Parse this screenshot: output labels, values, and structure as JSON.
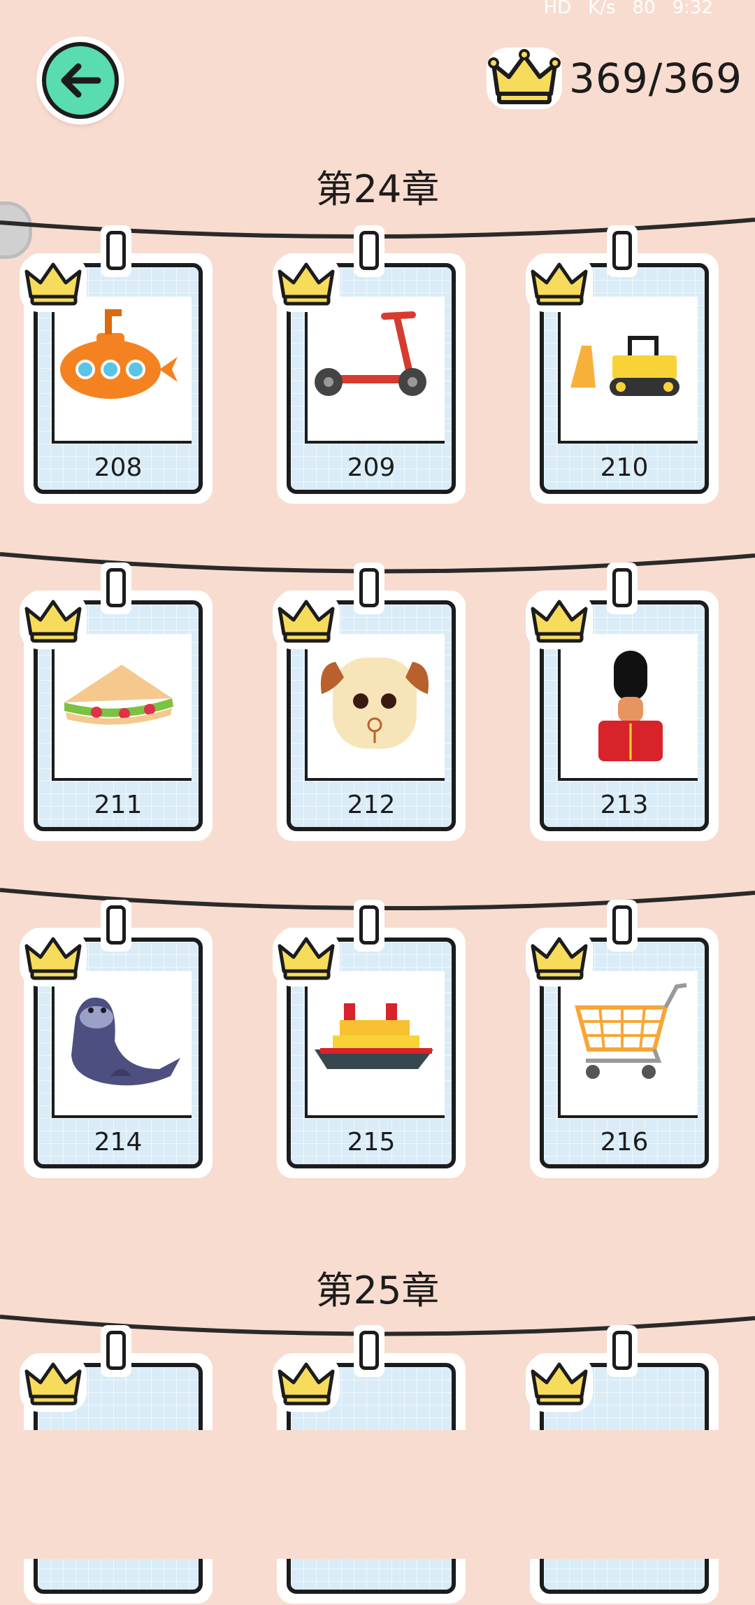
{
  "status_bar": {
    "network": "HD",
    "speed_unit": "K/s",
    "battery": "80",
    "time": "9:32"
  },
  "header": {
    "back_icon": "arrow-left-icon",
    "crown_icon": "crown-icon",
    "score": "369/369"
  },
  "colors": {
    "background": "#f8dccf",
    "back_button": "#59ddb0",
    "crown": "#f7dc5c",
    "card": "#d9ecf7"
  },
  "chapters": [
    {
      "title": "第24章",
      "cards": [
        {
          "number": "208",
          "icon": "submarine-icon"
        },
        {
          "number": "209",
          "icon": "scooter-icon"
        },
        {
          "number": "210",
          "icon": "bulldozer-icon"
        },
        {
          "number": "211",
          "icon": "sandwich-icon"
        },
        {
          "number": "212",
          "icon": "dog-icon"
        },
        {
          "number": "213",
          "icon": "royal-guard-icon"
        },
        {
          "number": "214",
          "icon": "seal-icon"
        },
        {
          "number": "215",
          "icon": "ship-icon"
        },
        {
          "number": "216",
          "icon": "shopping-cart-icon"
        }
      ]
    },
    {
      "title": "第25章",
      "cards": [
        {
          "number": "",
          "icon": "bread-icon"
        },
        {
          "number": "",
          "icon": "item-icon"
        },
        {
          "number": "",
          "icon": "item-icon"
        }
      ]
    }
  ]
}
